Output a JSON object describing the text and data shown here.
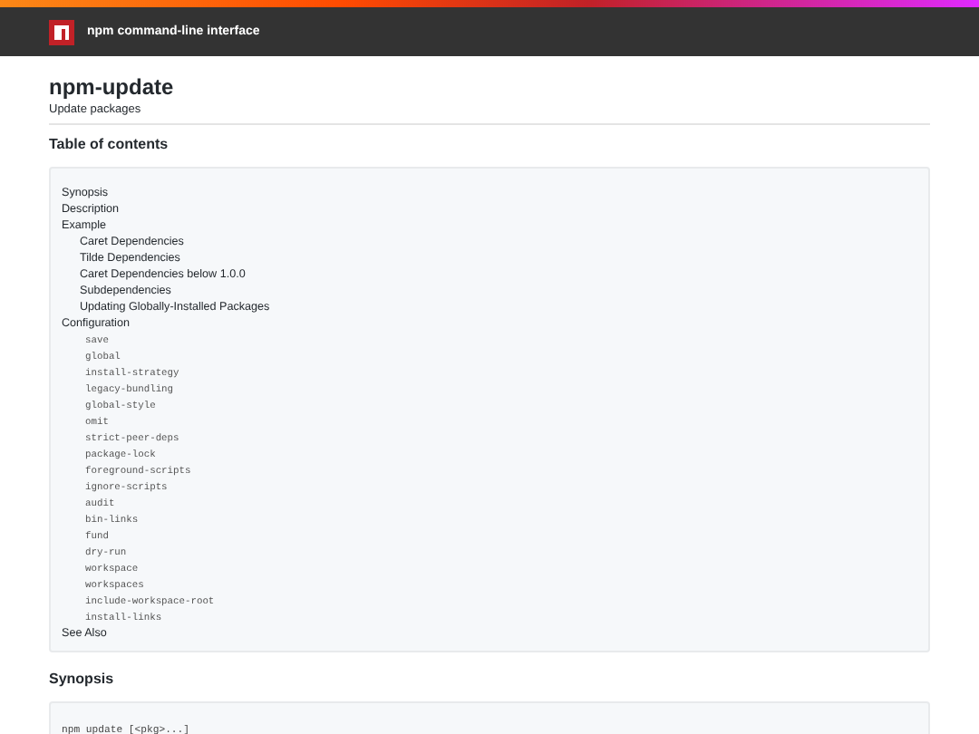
{
  "header": {
    "title": "npm command-line interface"
  },
  "page": {
    "title": "npm-update",
    "subtitle": "Update packages"
  },
  "toc": {
    "heading": "Table of contents",
    "items": [
      {
        "label": "Synopsis"
      },
      {
        "label": "Description"
      },
      {
        "label": "Example",
        "children": [
          {
            "label": "Caret Dependencies",
            "kind": "text"
          },
          {
            "label": "Tilde Dependencies",
            "kind": "text"
          },
          {
            "label": "Caret Dependencies below 1.0.0",
            "kind": "text"
          },
          {
            "label": "Subdependencies",
            "kind": "text"
          },
          {
            "label": "Updating Globally-Installed Packages",
            "kind": "text"
          }
        ]
      },
      {
        "label": "Configuration",
        "children": [
          {
            "label": "save",
            "kind": "code"
          },
          {
            "label": "global",
            "kind": "code"
          },
          {
            "label": "install-strategy",
            "kind": "code"
          },
          {
            "label": "legacy-bundling",
            "kind": "code"
          },
          {
            "label": "global-style",
            "kind": "code"
          },
          {
            "label": "omit",
            "kind": "code"
          },
          {
            "label": "strict-peer-deps",
            "kind": "code"
          },
          {
            "label": "package-lock",
            "kind": "code"
          },
          {
            "label": "foreground-scripts",
            "kind": "code"
          },
          {
            "label": "ignore-scripts",
            "kind": "code"
          },
          {
            "label": "audit",
            "kind": "code"
          },
          {
            "label": "bin-links",
            "kind": "code"
          },
          {
            "label": "fund",
            "kind": "code"
          },
          {
            "label": "dry-run",
            "kind": "code"
          },
          {
            "label": "workspace",
            "kind": "code"
          },
          {
            "label": "workspaces",
            "kind": "code"
          },
          {
            "label": "include-workspace-root",
            "kind": "code"
          },
          {
            "label": "install-links",
            "kind": "code"
          }
        ]
      },
      {
        "label": "See Also"
      }
    ]
  },
  "synopsis": {
    "heading": "Synopsis",
    "code": "npm update [<pkg>...]"
  }
}
